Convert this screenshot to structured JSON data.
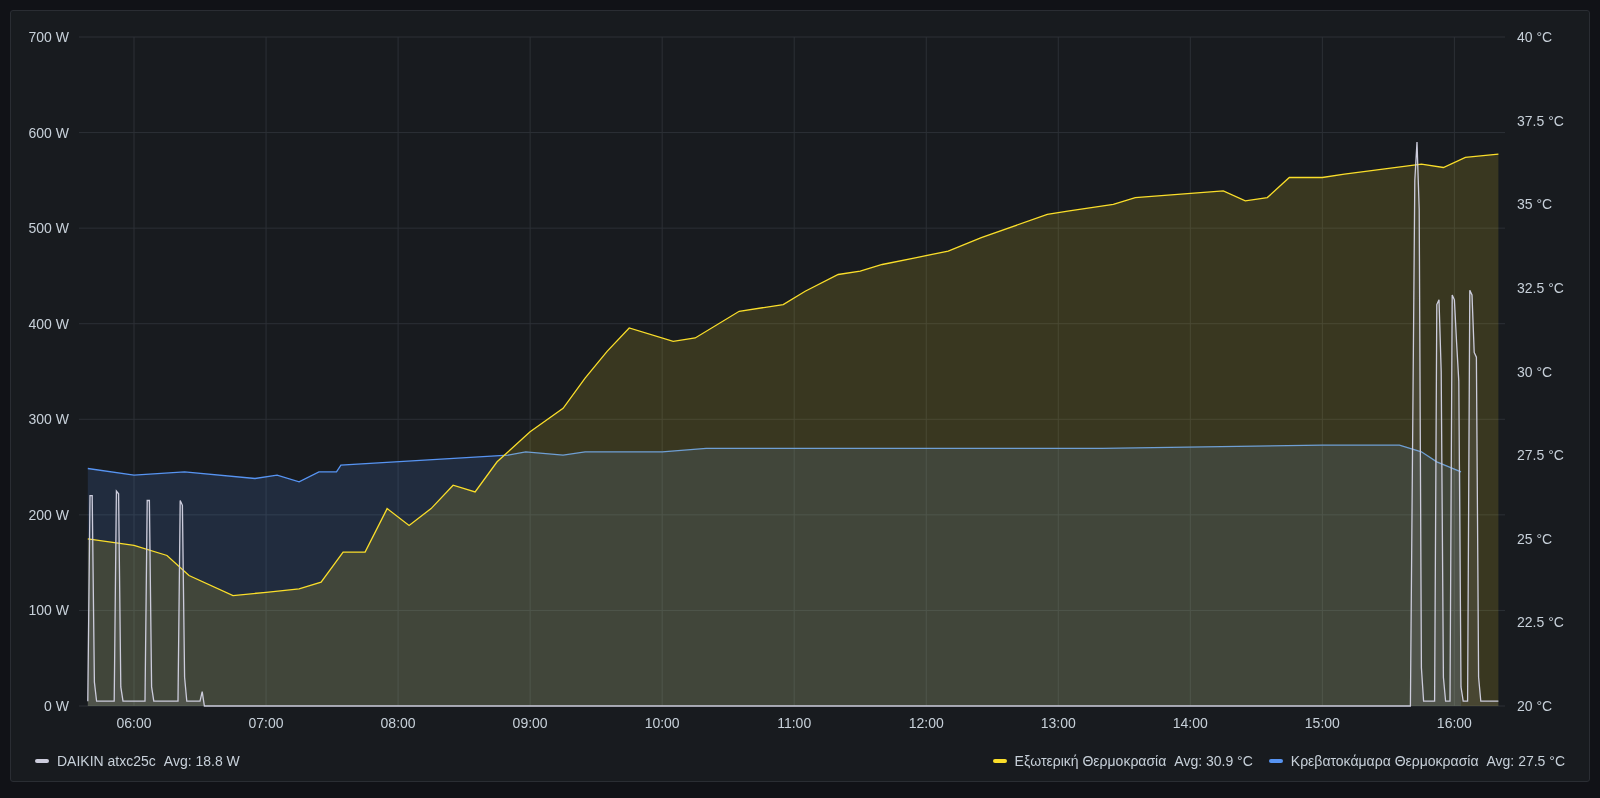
{
  "chart": {
    "chart_data": {
      "type": "area",
      "grid": true,
      "xlim": [
        335,
        983
      ],
      "ylim": [
        0,
        700
      ],
      "y2lim": [
        20,
        40
      ],
      "xticks": [
        {
          "value": 360,
          "label": "06:00"
        },
        {
          "value": 420,
          "label": "07:00"
        },
        {
          "value": 480,
          "label": "08:00"
        },
        {
          "value": 540,
          "label": "09:00"
        },
        {
          "value": 600,
          "label": "10:00"
        },
        {
          "value": 660,
          "label": "11:00"
        },
        {
          "value": 720,
          "label": "12:00"
        },
        {
          "value": 780,
          "label": "13:00"
        },
        {
          "value": 840,
          "label": "14:00"
        },
        {
          "value": 900,
          "label": "15:00"
        },
        {
          "value": 960,
          "label": "16:00"
        }
      ],
      "yticks": [
        {
          "value": 0,
          "label": "0 W"
        },
        {
          "value": 100,
          "label": "100 W"
        },
        {
          "value": 200,
          "label": "200 W"
        },
        {
          "value": 300,
          "label": "300 W"
        },
        {
          "value": 400,
          "label": "400 W"
        },
        {
          "value": 500,
          "label": "500 W"
        },
        {
          "value": 600,
          "label": "600 W"
        },
        {
          "value": 700,
          "label": "700 W"
        }
      ],
      "y2ticks": [
        {
          "value": 20,
          "label": "20 °C"
        },
        {
          "value": 22.5,
          "label": "22.5 °C"
        },
        {
          "value": 25,
          "label": "25 °C"
        },
        {
          "value": 27.5,
          "label": "27.5 °C"
        },
        {
          "value": 30,
          "label": "30 °C"
        },
        {
          "value": 32.5,
          "label": "32.5 °C"
        },
        {
          "value": 35,
          "label": "35 °C"
        },
        {
          "value": 37.5,
          "label": "37.5 °C"
        },
        {
          "value": 40,
          "label": "40 °C"
        }
      ],
      "series": [
        {
          "name": "DAIKIN atxc25c",
          "color": "#ccccdc",
          "x": [
            339,
            340,
            341,
            342,
            343,
            351,
            352,
            353,
            354,
            355,
            365,
            366,
            367,
            368,
            369,
            380,
            381,
            382,
            383,
            384,
            390,
            391,
            392,
            940,
            942,
            943,
            944,
            945,
            946,
            951,
            952,
            953,
            954,
            955,
            956,
            958,
            959,
            960,
            961,
            962,
            963,
            964,
            966,
            967,
            968,
            969,
            970,
            971,
            972,
            980
          ],
          "values": [
            5,
            220,
            220,
            25,
            5,
            5,
            225,
            222,
            20,
            5,
            5,
            215,
            215,
            20,
            5,
            5,
            215,
            210,
            30,
            5,
            5,
            15,
            0,
            0,
            550,
            590,
            520,
            40,
            5,
            5,
            420,
            425,
            350,
            30,
            5,
            5,
            430,
            425,
            380,
            340,
            20,
            5,
            5,
            435,
            430,
            370,
            365,
            30,
            5,
            5
          ]
        },
        {
          "name": "Εξωτερική Θερμοκρασία",
          "color": "#fade2a",
          "axis": "y2",
          "x": [
            339,
            360,
            375,
            385,
            405,
            420,
            435,
            445,
            455,
            465,
            475,
            485,
            495,
            505,
            515,
            525,
            540,
            555,
            565,
            575,
            585,
            605,
            615,
            635,
            655,
            665,
            680,
            690,
            700,
            715,
            730,
            745,
            775,
            785,
            805,
            815,
            855,
            865,
            875,
            885,
            900,
            910,
            945,
            955,
            965,
            980
          ],
          "values": [
            25,
            24.8,
            24.5,
            23.9,
            23.3,
            23.4,
            23.5,
            23.7,
            24.6,
            24.6,
            25.9,
            25.4,
            25.9,
            26.6,
            26.4,
            27.3,
            28.2,
            28.9,
            29.8,
            30.6,
            31.3,
            30.9,
            31,
            31.8,
            32,
            32.4,
            32.9,
            33,
            33.2,
            33.4,
            33.6,
            34,
            34.7,
            34.8,
            35,
            35.2,
            35.4,
            35.1,
            35.2,
            35.8,
            35.8,
            35.9,
            36.2,
            36.1,
            36.4,
            36.5
          ]
        },
        {
          "name": "Κρεβατοκάμαρα Θερμοκρασία",
          "color": "#5794f2",
          "axis": "y2",
          "x": [
            339,
            360,
            383,
            415,
            425,
            435,
            444,
            452,
            454,
            530,
            538,
            555,
            565,
            600,
            620,
            700,
            800,
            900,
            935,
            945,
            952,
            963
          ],
          "values": [
            27.1,
            26.9,
            27,
            26.8,
            26.9,
            26.7,
            27,
            27,
            27.2,
            27.5,
            27.6,
            27.5,
            27.6,
            27.6,
            27.7,
            27.7,
            27.7,
            27.8,
            27.8,
            27.6,
            27.3,
            27
          ]
        }
      ]
    },
    "legend": [
      {
        "avg": "Avg: 18.8 W"
      },
      {
        "avg": "Avg: 30.9 °C"
      },
      {
        "avg": "Avg: 27.5 °C"
      }
    ]
  }
}
